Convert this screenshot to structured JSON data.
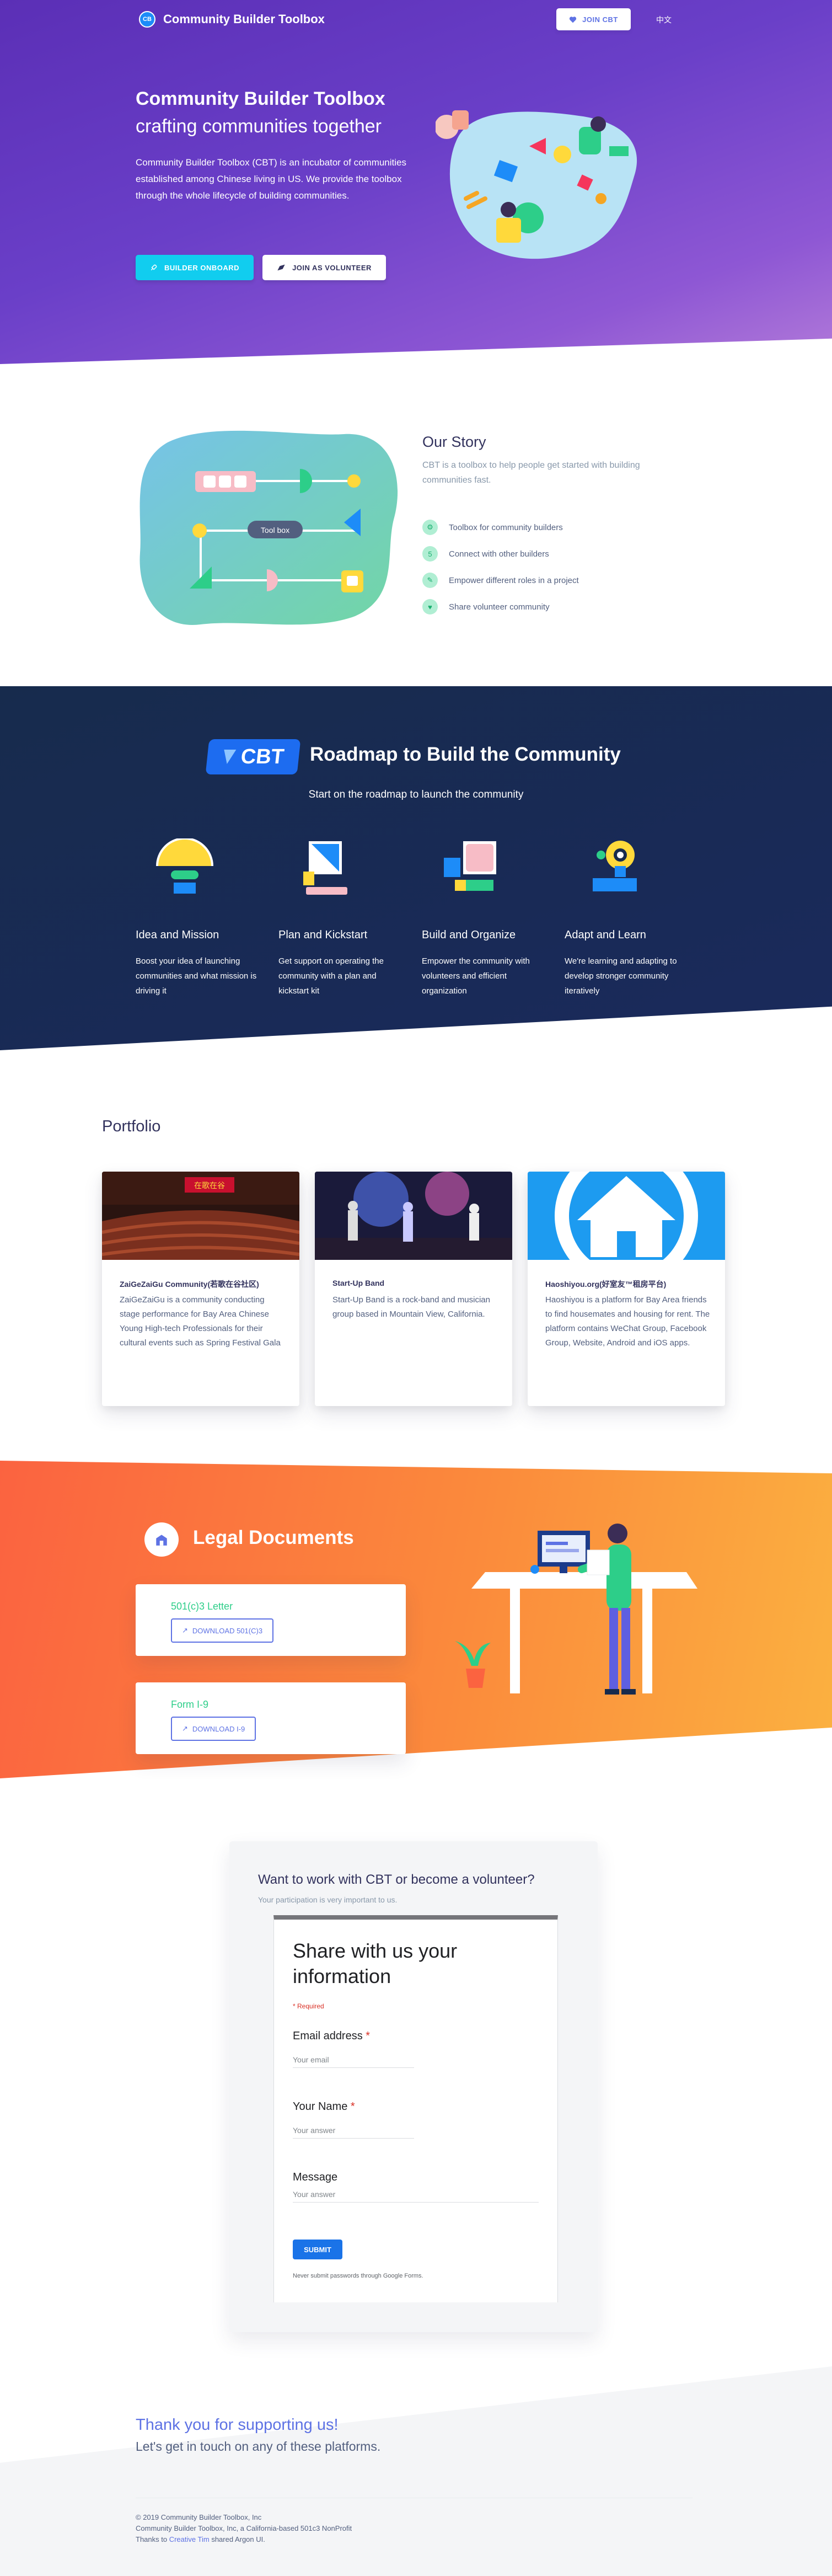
{
  "nav": {
    "brand": "Community Builder Toolbox",
    "brand_badge": "CB",
    "join_label": "JOIN CBT",
    "lang": "中文"
  },
  "hero": {
    "title": "Community Builder Toolbox",
    "subtitle": "crafting communities together",
    "description": "Community Builder Toolbox (CBT) is an incubator of communities established among Chinese living in US. We provide the toolbox through the whole lifecycle of building communities.",
    "btn_onboard": "BUILDER ONBOARD",
    "btn_volunteer": "JOIN AS VOLUNTEER"
  },
  "story": {
    "title": "Our Story",
    "description": "CBT is a toolbox to help people get started with building communities fast.",
    "diagram_label": "Tool box",
    "features": [
      {
        "icon": "settings-icon",
        "label": "Toolbox for community builders"
      },
      {
        "icon": "html5-icon",
        "label": "Connect with other builders"
      },
      {
        "icon": "ruler-pencil-icon",
        "label": "Empower different roles in a project"
      },
      {
        "icon": "heart-icon",
        "label": "Share volunteer community"
      }
    ]
  },
  "roadmap": {
    "logo_text": "CBT",
    "title": "Roadmap to Build the Community",
    "subtitle": "Start on the roadmap to launch the community",
    "steps": [
      {
        "title": "Idea and Mission",
        "text": "Boost your idea of launching communities and what mission is driving it"
      },
      {
        "title": "Plan and Kickstart",
        "text": "Get support on operating the community with a plan and kickstart kit"
      },
      {
        "title": "Build and Organize",
        "text": "Empower the community with volunteers and efficient organization"
      },
      {
        "title": "Adapt and Learn",
        "text": "We're learning and adapting to develop stronger community iteratively"
      }
    ]
  },
  "portfolio": {
    "title": "Portfolio",
    "items": [
      {
        "title": "ZaiGeZaiGu Community(若歌在谷社区)",
        "text": "ZaiGeZaiGu is a community conducting stage performance for Bay Area Chinese Young High-tech Professionals for their cultural events such as Spring Festival Gala",
        "banner": "在歌在谷"
      },
      {
        "title": "Start-Up Band",
        "text": "Start-Up Band is a rock-band and musician group based in Mountain View, California."
      },
      {
        "title": "Haoshiyou.org(好室友™租房平台)",
        "text": "Haoshiyou is a platform for Bay Area friends to find housemates and housing for rent. The platform contains WeChat Group, Facebook Group, Website, Android and iOS apps."
      }
    ]
  },
  "legal": {
    "title": "Legal Documents",
    "docs": [
      {
        "name": "501(c)3 Letter",
        "button": "DOWNLOAD 501(C)3"
      },
      {
        "name": "Form I-9",
        "button": "DOWNLOAD I-9"
      }
    ]
  },
  "form": {
    "question": "Want to work with CBT or become a volunteer?",
    "hint": "Your participation is very important to us.",
    "gtitle": "Share with us your information",
    "required_note": "* Required",
    "email_label": "Email address",
    "email_placeholder": "Your email",
    "name_label": "Your Name",
    "name_placeholder": "Your answer",
    "message_label": "Message",
    "message_placeholder": "Your answer",
    "required_star": "*",
    "submit": "SUBMIT",
    "footer_note": "Never submit passwords through Google Forms."
  },
  "footer": {
    "thanks": "Thank you for supporting us!",
    "touch": "Let's get in touch on any of these platforms.",
    "copyright": "© 2019 Community Builder Toolbox, Inc",
    "nonprofit": "Community Builder Toolbox, Inc, a California-based 501c3 NonProfit",
    "thanks_prefix": "Thanks to",
    "thanks_link": "Creative Tim",
    "thanks_suffix": "shared Argon UI."
  },
  "colors": {
    "primary": "#5e72e4",
    "info": "#11cdef",
    "success": "#2dce89",
    "warning": "#fb6340",
    "dark": "#172b4d"
  }
}
